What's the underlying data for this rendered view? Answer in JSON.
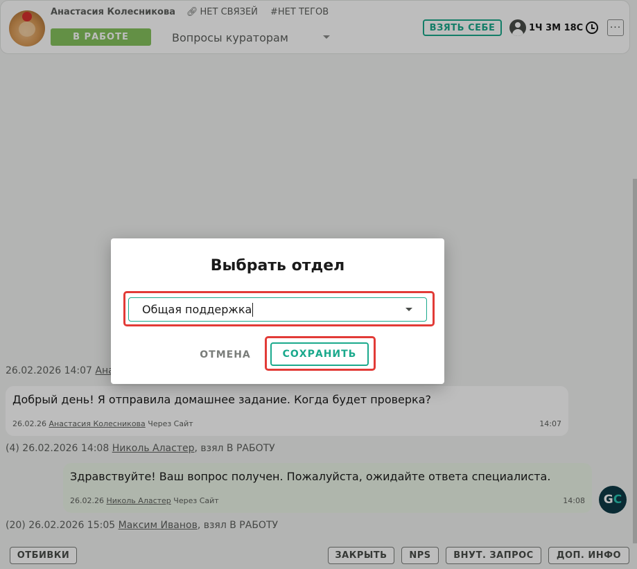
{
  "header": {
    "client_name": "Анастасия Колесникова",
    "links_label": "НЕТ СВЯЗЕЙ",
    "tags_label": "#НЕТ ТЕГОВ",
    "status": "В РАБОТЕ",
    "department": "Вопросы кураторам",
    "take_label": "ВЗЯТЬ СЕБЕ",
    "timer": "1Ч 3М 18С",
    "more_label": "···"
  },
  "chat": {
    "event_partial": "26.02.2026 14:07",
    "event_partial_author": "Ана",
    "client_message": {
      "text": "Добрый день! Я отправила домашнее задание. Когда будет проверка?",
      "date": "26.02.26",
      "author": "Анастасия Колесникова",
      "channel": "Через Сайт",
      "time": "14:07"
    },
    "event_1": {
      "count": "(4)",
      "datetime": "26.02.2026 14:08",
      "author": "Николь Аластер",
      "action": ", взял В РАБОТУ"
    },
    "agent_message": {
      "text": "Здравствуйте! Ваш вопрос получен. Пожалуйста, ожидайте ответа специалиста.",
      "date": "26.02.26",
      "author": "Николь Аластер",
      "channel": "Через Сайт",
      "time": "14:08",
      "avatar_g": "G",
      "avatar_c": "C"
    },
    "event_2": {
      "count": "(20)",
      "datetime": "26.02.2026 15:05",
      "author": "Максим Иванов",
      "action": ", взял В РАБОТУ"
    }
  },
  "footer": {
    "otbivki": "ОТБИВКИ",
    "close": "ЗАКРЫТЬ",
    "nps": "NPS",
    "internal_request": "ВНУТ. ЗАПРОС",
    "extra_info": "ДОП. ИНФО"
  },
  "modal": {
    "title": "Выбрать отдел",
    "selected_department": "Общая поддержка",
    "cancel_label": "ОТМЕНА",
    "save_label": "СОХРАНИТЬ"
  },
  "colors": {
    "accent": "#1aa98c",
    "status_green": "#86c35e",
    "highlight_red": "#e23b37"
  }
}
